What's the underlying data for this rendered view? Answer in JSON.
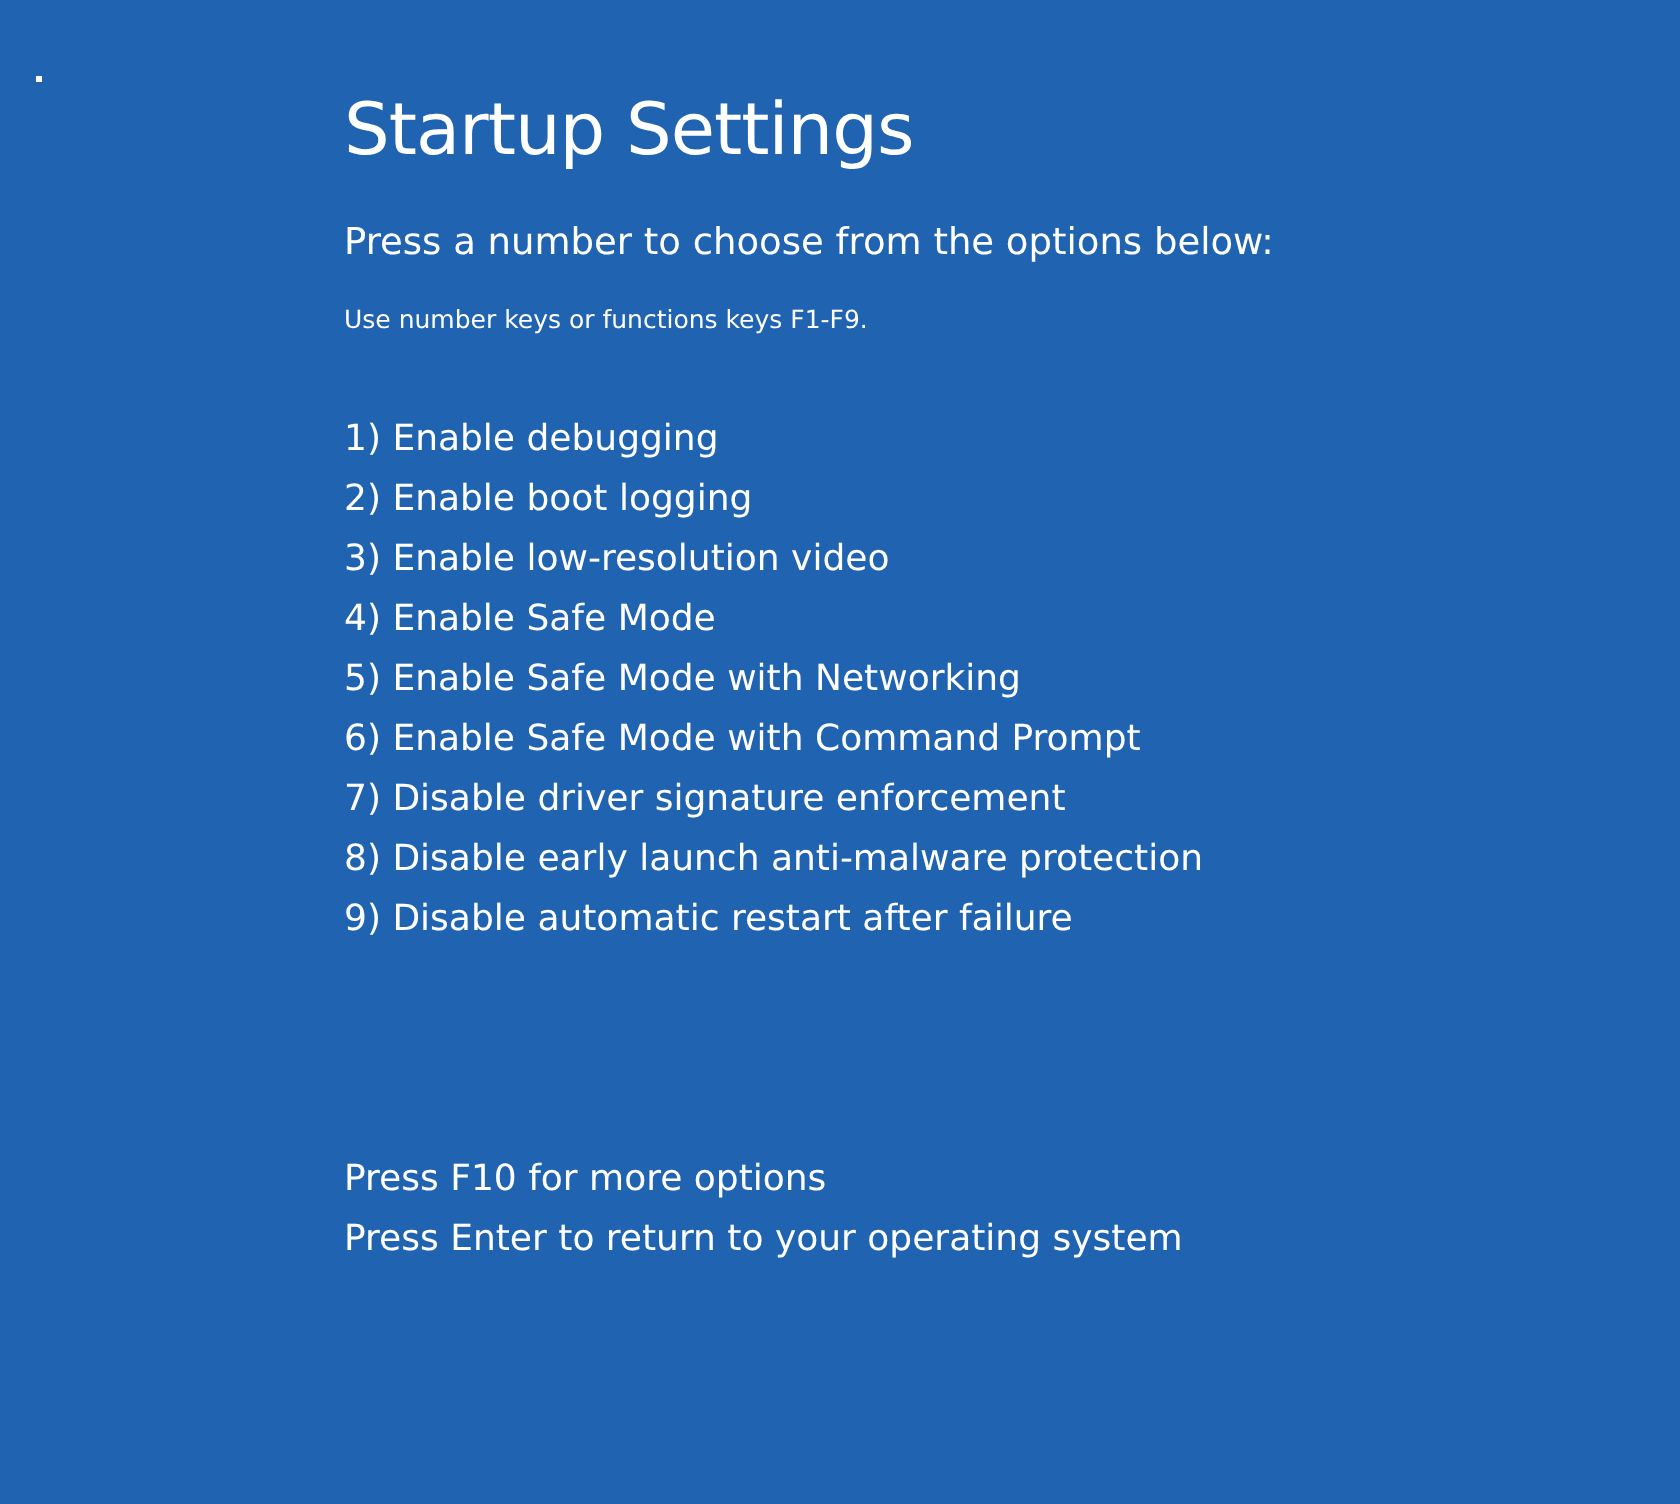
{
  "title": "Startup Settings",
  "subtitle": "Press a number to choose from the options below:",
  "hint": "Use number keys or functions keys F1-F9.",
  "options": [
    "1) Enable debugging",
    "2) Enable boot logging",
    "3) Enable low-resolution video",
    "4) Enable Safe Mode",
    "5) Enable Safe Mode with Networking",
    "6) Enable Safe Mode with Command Prompt",
    "7) Disable driver signature enforcement",
    "8) Disable early launch anti-malware protection",
    "9) Disable automatic restart after failure"
  ],
  "footer": [
    "Press F10 for more options",
    "Press Enter to return to your operating system"
  ]
}
